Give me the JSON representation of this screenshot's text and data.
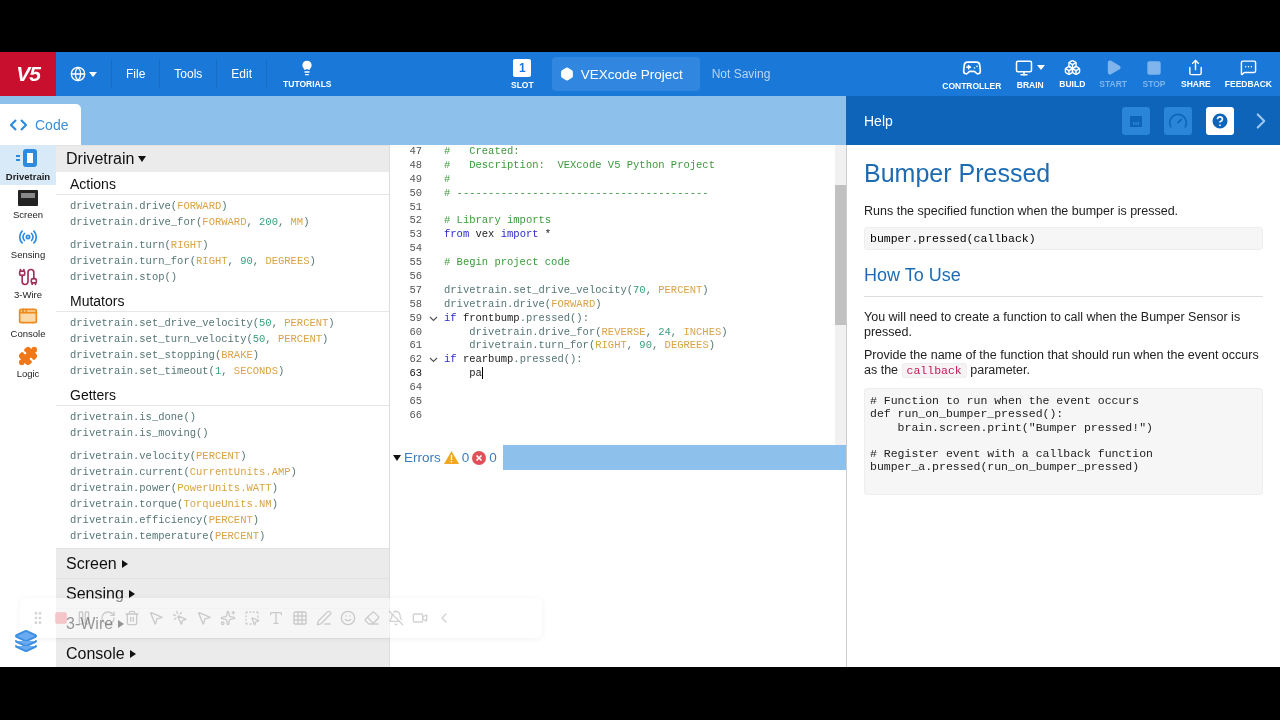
{
  "toolbar": {
    "logo": "V5",
    "menus": [
      {
        "label": "File"
      },
      {
        "label": "Tools"
      },
      {
        "label": "Edit"
      }
    ],
    "tutorials": "TUTORIALS",
    "slot": {
      "number": "1",
      "label": "SLOT"
    },
    "project_name": "VEXcode Project",
    "save_status": "Not Saving",
    "actions": [
      {
        "label": "CONTROLLER",
        "disabled": false
      },
      {
        "label": "BRAIN",
        "disabled": false
      },
      {
        "label": "BUILD",
        "disabled": false
      },
      {
        "label": "START",
        "disabled": true
      },
      {
        "label": "STOP",
        "disabled": true
      },
      {
        "label": "SHARE",
        "disabled": false
      },
      {
        "label": "FEEDBACK",
        "disabled": false
      }
    ]
  },
  "tabs": [
    {
      "label": "Code",
      "selected": true
    }
  ],
  "rail": {
    "items": [
      {
        "label": "Drivetrain",
        "selected": true
      },
      {
        "label": "Screen",
        "selected": false
      },
      {
        "label": "Sensing",
        "selected": false
      },
      {
        "label": "3-Wire",
        "selected": false
      },
      {
        "label": "Console",
        "selected": false
      },
      {
        "label": "Logic",
        "selected": false
      }
    ]
  },
  "palette": {
    "categories": [
      {
        "title": "Drivetrain",
        "expanded": true,
        "sections": [
          {
            "title": "Actions",
            "groups": [
              [
                [
                  {
                    "kind": "code",
                    "text": "drivetrain.drive("
                  },
                  {
                    "kind": "const",
                    "text": "FORWARD"
                  },
                  {
                    "kind": "code",
                    "text": ")"
                  }
                ],
                [
                  {
                    "kind": "code",
                    "text": "drivetrain.drive_for("
                  },
                  {
                    "kind": "const",
                    "text": "FORWARD"
                  },
                  {
                    "kind": "code",
                    "text": ", "
                  },
                  {
                    "kind": "num",
                    "text": "200"
                  },
                  {
                    "kind": "code",
                    "text": ", "
                  },
                  {
                    "kind": "const",
                    "text": "MM"
                  },
                  {
                    "kind": "code",
                    "text": ")"
                  }
                ]
              ],
              [
                [
                  {
                    "kind": "code",
                    "text": "drivetrain.turn("
                  },
                  {
                    "kind": "const",
                    "text": "RIGHT"
                  },
                  {
                    "kind": "code",
                    "text": ")"
                  }
                ],
                [
                  {
                    "kind": "code",
                    "text": "drivetrain.turn_for("
                  },
                  {
                    "kind": "const",
                    "text": "RIGHT"
                  },
                  {
                    "kind": "code",
                    "text": ", "
                  },
                  {
                    "kind": "num",
                    "text": "90"
                  },
                  {
                    "kind": "code",
                    "text": ", "
                  },
                  {
                    "kind": "const",
                    "text": "DEGREES"
                  },
                  {
                    "kind": "code",
                    "text": ")"
                  }
                ],
                [
                  {
                    "kind": "code",
                    "text": "drivetrain.stop()"
                  }
                ]
              ]
            ]
          },
          {
            "title": "Mutators",
            "groups": [
              [
                [
                  {
                    "kind": "code",
                    "text": "drivetrain.set_drive_velocity("
                  },
                  {
                    "kind": "num",
                    "text": "50"
                  },
                  {
                    "kind": "code",
                    "text": ", "
                  },
                  {
                    "kind": "const",
                    "text": "PERCENT"
                  },
                  {
                    "kind": "code",
                    "text": ")"
                  }
                ],
                [
                  {
                    "kind": "code",
                    "text": "drivetrain.set_turn_velocity("
                  },
                  {
                    "kind": "num",
                    "text": "50"
                  },
                  {
                    "kind": "code",
                    "text": ", "
                  },
                  {
                    "kind": "const",
                    "text": "PERCENT"
                  },
                  {
                    "kind": "code",
                    "text": ")"
                  }
                ],
                [
                  {
                    "kind": "code",
                    "text": "drivetrain.set_stopping("
                  },
                  {
                    "kind": "const",
                    "text": "BRAKE"
                  },
                  {
                    "kind": "code",
                    "text": ")"
                  }
                ],
                [
                  {
                    "kind": "code",
                    "text": "drivetrain.set_timeout("
                  },
                  {
                    "kind": "num",
                    "text": "1"
                  },
                  {
                    "kind": "code",
                    "text": ", "
                  },
                  {
                    "kind": "const",
                    "text": "SECONDS"
                  },
                  {
                    "kind": "code",
                    "text": ")"
                  }
                ]
              ]
            ]
          },
          {
            "title": "Getters",
            "groups": [
              [
                [
                  {
                    "kind": "code",
                    "text": "drivetrain.is_done()"
                  }
                ],
                [
                  {
                    "kind": "code",
                    "text": "drivetrain.is_moving()"
                  }
                ]
              ],
              [
                [
                  {
                    "kind": "code",
                    "text": "drivetrain.velocity("
                  },
                  {
                    "kind": "const",
                    "text": "PERCENT"
                  },
                  {
                    "kind": "code",
                    "text": ")"
                  }
                ],
                [
                  {
                    "kind": "code",
                    "text": "drivetrain.current("
                  },
                  {
                    "kind": "const",
                    "text": "CurrentUnits.AMP"
                  },
                  {
                    "kind": "code",
                    "text": ")"
                  }
                ],
                [
                  {
                    "kind": "code",
                    "text": "drivetrain.power("
                  },
                  {
                    "kind": "const",
                    "text": "PowerUnits.WATT"
                  },
                  {
                    "kind": "code",
                    "text": ")"
                  }
                ],
                [
                  {
                    "kind": "code",
                    "text": "drivetrain.torque("
                  },
                  {
                    "kind": "const",
                    "text": "TorqueUnits.NM"
                  },
                  {
                    "kind": "code",
                    "text": ")"
                  }
                ],
                [
                  {
                    "kind": "code",
                    "text": "drivetrain.efficiency("
                  },
                  {
                    "kind": "const",
                    "text": "PERCENT"
                  },
                  {
                    "kind": "code",
                    "text": ")"
                  }
                ],
                [
                  {
                    "kind": "code",
                    "text": "drivetrain.temperature("
                  },
                  {
                    "kind": "const",
                    "text": "PERCENT"
                  },
                  {
                    "kind": "code",
                    "text": ")"
                  }
                ]
              ]
            ]
          }
        ]
      },
      {
        "title": "Screen",
        "expanded": false
      },
      {
        "title": "Sensing",
        "expanded": false
      },
      {
        "title": "3-Wire",
        "expanded": false
      },
      {
        "title": "Console",
        "expanded": false
      }
    ]
  },
  "editor": {
    "lines": [
      {
        "number": "47",
        "fold": false,
        "cursor": false,
        "tokens": [
          {
            "kind": "comment",
            "text": "#   Created:"
          }
        ]
      },
      {
        "number": "48",
        "fold": false,
        "cursor": false,
        "tokens": [
          {
            "kind": "comment",
            "text": "#   Description:  VEXcode V5 Python Project"
          }
        ]
      },
      {
        "number": "49",
        "fold": false,
        "cursor": false,
        "tokens": [
          {
            "kind": "comment",
            "text": "#"
          }
        ]
      },
      {
        "number": "50",
        "fold": false,
        "cursor": false,
        "tokens": [
          {
            "kind": "comment",
            "text": "# ----------------------------------------"
          }
        ]
      },
      {
        "number": "51",
        "fold": false,
        "cursor": false
      },
      {
        "number": "52",
        "fold": false,
        "cursor": false,
        "tokens": [
          {
            "kind": "comment",
            "text": "# Library imports"
          }
        ]
      },
      {
        "number": "53",
        "fold": false,
        "cursor": false,
        "tokens": [
          {
            "kind": "keyword",
            "text": "from"
          },
          {
            "kind": "plain",
            "text": " vex "
          },
          {
            "kind": "keyword",
            "text": "import"
          },
          {
            "kind": "plain",
            "text": " *"
          }
        ]
      },
      {
        "number": "54",
        "fold": false,
        "cursor": false
      },
      {
        "number": "55",
        "fold": false,
        "cursor": false,
        "tokens": [
          {
            "kind": "comment",
            "text": "# Begin project code"
          }
        ]
      },
      {
        "number": "56",
        "fold": false,
        "cursor": false
      },
      {
        "number": "57",
        "fold": false,
        "cursor": false,
        "tokens": [
          {
            "kind": "code",
            "text": "drivetrain.set_drive_velocity("
          },
          {
            "kind": "num",
            "text": "70"
          },
          {
            "kind": "code",
            "text": ", "
          },
          {
            "kind": "const",
            "text": "PERCENT"
          },
          {
            "kind": "code",
            "text": ")"
          }
        ]
      },
      {
        "number": "58",
        "fold": false,
        "cursor": false,
        "tokens": [
          {
            "kind": "code",
            "text": "drivetrain.drive("
          },
          {
            "kind": "const",
            "text": "FORWARD"
          },
          {
            "kind": "code",
            "text": ")"
          }
        ]
      },
      {
        "number": "59",
        "fold": true,
        "cursor": false,
        "tokens": [
          {
            "kind": "keyword",
            "text": "if"
          },
          {
            "kind": "plain",
            "text": " frontbump"
          },
          {
            "kind": "code",
            "text": ".pressed():"
          }
        ]
      },
      {
        "number": "60",
        "fold": false,
        "cursor": false,
        "tokens": [
          {
            "kind": "code",
            "text": "    drivetrain.drive_for("
          },
          {
            "kind": "const",
            "text": "REVERSE"
          },
          {
            "kind": "code",
            "text": ", "
          },
          {
            "kind": "num",
            "text": "24"
          },
          {
            "kind": "code",
            "text": ", "
          },
          {
            "kind": "const",
            "text": "INCHES"
          },
          {
            "kind": "code",
            "text": ")"
          }
        ]
      },
      {
        "number": "61",
        "fold": false,
        "cursor": false,
        "tokens": [
          {
            "kind": "code",
            "text": "    drivetrain.turn_for("
          },
          {
            "kind": "const",
            "text": "RIGHT"
          },
          {
            "kind": "code",
            "text": ", "
          },
          {
            "kind": "num",
            "text": "90"
          },
          {
            "kind": "code",
            "text": ", "
          },
          {
            "kind": "const",
            "text": "DEGREES"
          },
          {
            "kind": "code",
            "text": ")"
          }
        ]
      },
      {
        "number": "62",
        "fold": true,
        "cursor": false,
        "tokens": [
          {
            "kind": "keyword",
            "text": "if"
          },
          {
            "kind": "plain",
            "text": " rearbump"
          },
          {
            "kind": "code",
            "text": ".pressed():"
          }
        ]
      },
      {
        "number": "63",
        "fold": false,
        "cursor": true,
        "tokens": [
          {
            "kind": "plain",
            "text": "    pa"
          }
        ]
      },
      {
        "number": "64",
        "fold": false,
        "cursor": false
      },
      {
        "number": "65",
        "fold": false,
        "cursor": false
      },
      {
        "number": "66",
        "fold": false,
        "cursor": false
      }
    ]
  },
  "errors": {
    "label": "Errors",
    "expanded": true,
    "warnings": "0",
    "errors": "0"
  },
  "help": {
    "title": "Help",
    "buttons": [
      {
        "selected": false
      },
      {
        "selected": false
      },
      {
        "selected": true
      }
    ],
    "heading": "Bumper Pressed",
    "summary": "Runs the specified function when the bumper is pressed.",
    "signature": "bumper.pressed(callback)",
    "subheading": "How To Use",
    "paragraphs": [
      {
        "parts": [
          {
            "kind": "text",
            "text": "You will need to create a function to call when the Bumper Sensor is pressed."
          }
        ]
      },
      {
        "parts": [
          {
            "kind": "text",
            "text": "Provide the name of the function that should run when the event occurs as the "
          },
          {
            "kind": "code",
            "text": "callback"
          },
          {
            "kind": "text",
            "text": " parameter."
          }
        ]
      }
    ],
    "example": "# Function to run when the event occurs\ndef run_on_bumper_pressed():\n    brain.screen.print(\"Bumper pressed!\")\n\n# Register event with a callback function\nbumper_a.pressed(run_on_bumper_pressed)"
  }
}
